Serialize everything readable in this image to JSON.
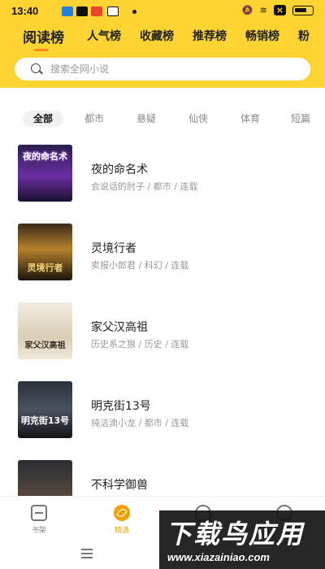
{
  "status_bar": {
    "time": "13:40",
    "battery_label": "×"
  },
  "header": {
    "tabs": [
      {
        "label": "阅读榜",
        "active": true
      },
      {
        "label": "人气榜",
        "active": false
      },
      {
        "label": "收藏榜",
        "active": false
      },
      {
        "label": "推荐榜",
        "active": false
      },
      {
        "label": "畅销榜",
        "active": false
      },
      {
        "label": "粉",
        "active": false
      }
    ],
    "accent_color": "#fdd432",
    "indicator_color": "#ff8a1c"
  },
  "search": {
    "placeholder": "搜索全网小说"
  },
  "categories": [
    {
      "label": "全部",
      "active": true
    },
    {
      "label": "都市",
      "active": false
    },
    {
      "label": "悬疑",
      "active": false
    },
    {
      "label": "仙侠",
      "active": false
    },
    {
      "label": "体育",
      "active": false
    },
    {
      "label": "短篇",
      "active": false
    }
  ],
  "books": [
    {
      "title": "夜的命名术",
      "meta": "会说话的肘子 / 都市 / 连载",
      "cover_text": "夜的命名术"
    },
    {
      "title": "灵境行者",
      "meta": "卖报小郎君 / 科幻 / 连载",
      "cover_text": "灵境行者"
    },
    {
      "title": "家父汉高祖",
      "meta": "历史系之狼 / 历史 / 连载",
      "cover_text": "家父汉高祖"
    },
    {
      "title": "明克街13号",
      "meta": "纯洁滴小龙 / 都市 / 连载",
      "cover_text": "明克街13号"
    },
    {
      "title": "不科学御兽",
      "meta": "",
      "cover_text": ""
    }
  ],
  "bottom_nav": [
    {
      "label": "书架",
      "icon": "bookshelf-icon",
      "active": false
    },
    {
      "label": "精选",
      "icon": "featured-icon",
      "active": true
    },
    {
      "label": "",
      "icon": "category-icon",
      "active": false
    },
    {
      "label": "",
      "icon": "profile-icon",
      "active": false
    }
  ],
  "watermark": {
    "main": "下载鸟应用",
    "url": "www.xiazainiao.com"
  }
}
